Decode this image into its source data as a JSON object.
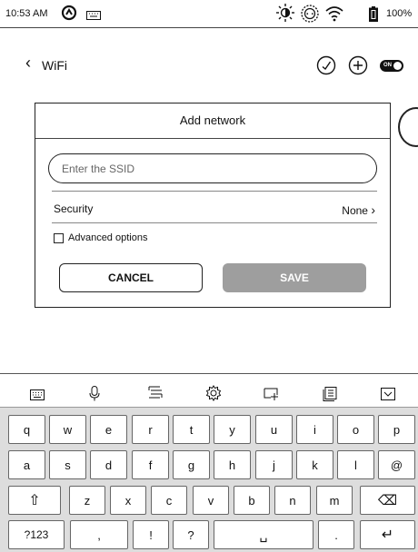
{
  "status_bar": {
    "time": "10:53 AM",
    "battery_percent": "100%",
    "icons": [
      "notification-icon",
      "keyboard-icon",
      "brightness-icon",
      "color-temp-icon",
      "wifi-icon",
      "battery-icon"
    ]
  },
  "header": {
    "back_icon": "‹",
    "title": "WiFi",
    "toggle_label": "ON",
    "icons": [
      "speed-gauge-icon",
      "add-icon",
      "wifi-toggle"
    ]
  },
  "dialog": {
    "title": "Add network",
    "ssid_placeholder": "Enter the SSID",
    "ssid_value": "",
    "security_label": "Security",
    "security_value": "None",
    "chevron": "›",
    "advanced_label": "Advanced options",
    "cancel_label": "CANCEL",
    "save_label": "SAVE"
  },
  "keyboard": {
    "toolbar": [
      "keyboard-icon",
      "microphone-icon",
      "clipboard-icon",
      "settings-icon",
      "text-cursor-icon",
      "notes-icon",
      "hide-keyboard-icon"
    ],
    "row1": [
      "q",
      "w",
      "e",
      "r",
      "t",
      "y",
      "u",
      "i",
      "o",
      "p"
    ],
    "row2": [
      "a",
      "s",
      "d",
      "f",
      "g",
      "h",
      "j",
      "k",
      "l",
      "@"
    ],
    "row3": [
      "z",
      "x",
      "c",
      "v",
      "b",
      "n",
      "m"
    ],
    "shift_icon": "⇧",
    "backspace_icon": "⌫",
    "symbols_label": "?123",
    "comma": ",",
    "exclaim": "!",
    "question": "?",
    "space_icon": "␣",
    "period": ".",
    "enter_icon": "↵"
  }
}
